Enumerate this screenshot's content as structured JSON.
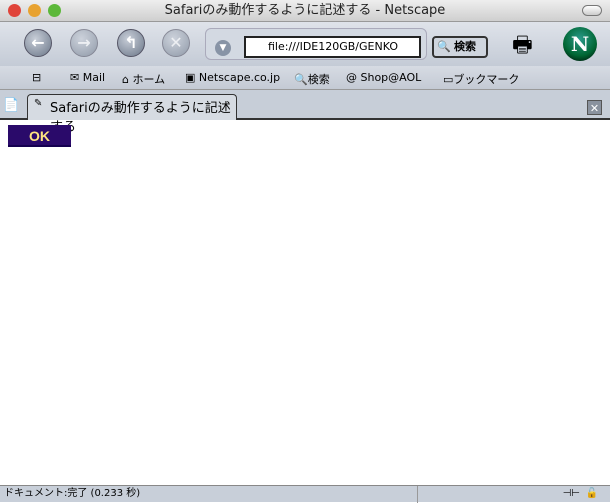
{
  "window": {
    "title": "Safariのみ動作するように記述する - Netscape"
  },
  "toolbar": {
    "back": "back",
    "forward": "forward",
    "reload": "reload",
    "stop": "stop",
    "url": "file:///IDE120GB/GENKO",
    "search_label": "検索"
  },
  "bookmarks": {
    "items": [
      "Mail",
      "ホーム",
      "Netscape.co.jp",
      "検索",
      "Shop@AOL",
      "ブックマーク"
    ]
  },
  "tab": {
    "label": "Safariのみ動作するように記述する"
  },
  "content": {
    "ok_button": "OK"
  },
  "status": {
    "text": "ドキュメント:完了 (0.233 秒)"
  }
}
